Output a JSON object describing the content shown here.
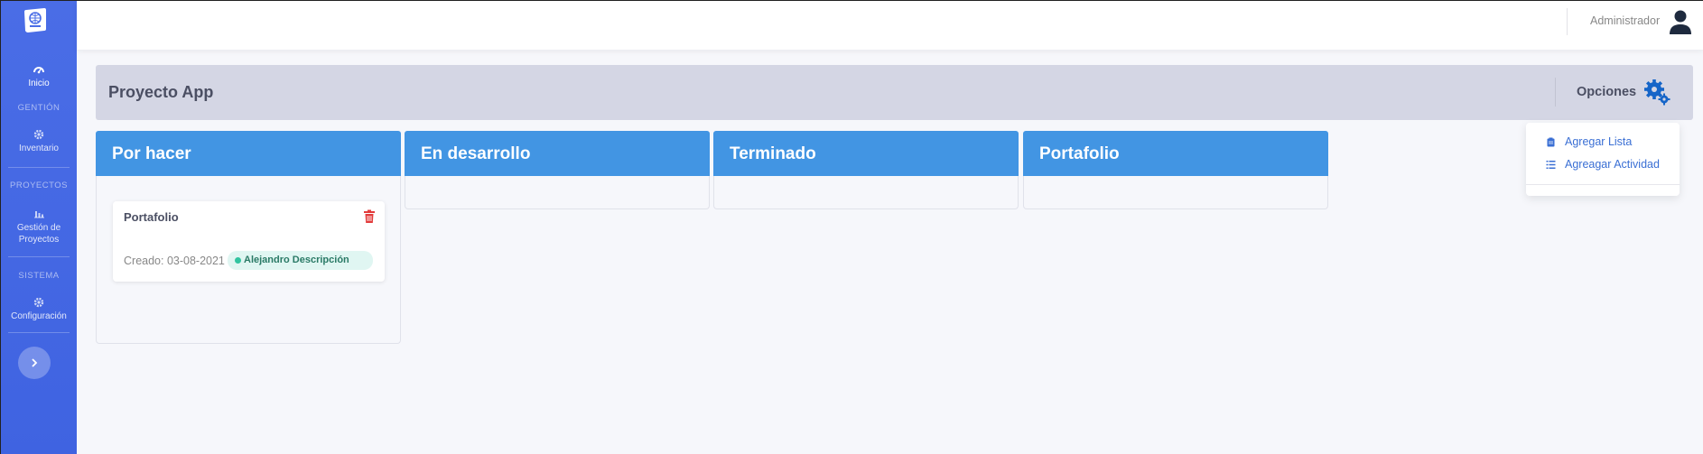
{
  "sidebar": {
    "items": [
      {
        "label": "Inicio",
        "icon": "dashboard-icon"
      },
      {
        "label": "Inventario",
        "icon": "gear-icon"
      },
      {
        "label": "Gestión de Proyectos",
        "icon": "bar-chart-icon"
      },
      {
        "label": "Configuración",
        "icon": "gear-icon"
      }
    ],
    "sections": [
      "GENTIÓN",
      "PROYECTOS",
      "SISTEMA"
    ],
    "expand_icon": "chevron-right-icon"
  },
  "header": {
    "user_name": "Administrador",
    "avatar_icon": "user-icon"
  },
  "project": {
    "title": "Proyecto App",
    "options_label": "Opciones",
    "options_icon": "gears-icon"
  },
  "dropdown": {
    "items": [
      {
        "label": "Agregar Lista",
        "icon": "clipboard-icon"
      },
      {
        "label": "Agreagar Actividad",
        "icon": "list-icon"
      }
    ]
  },
  "board": {
    "columns": [
      {
        "title": "Por hacer"
      },
      {
        "title": "En desarrollo"
      },
      {
        "title": "Terminado"
      },
      {
        "title": "Portafolio"
      }
    ],
    "card": {
      "title": "Portafolio",
      "created": "Creado: 03-08-2021",
      "assignee": "Alejandro Descripción",
      "delete_icon": "trash-icon"
    }
  },
  "colors": {
    "sidebar": "#4a6de6",
    "column_header": "#4295e3",
    "project_bar": "#d4d6e4",
    "link": "#3a6fd4",
    "delete": "#e23b3b",
    "badge_bg": "#e0f6f2",
    "badge_dot": "#31c4a0"
  }
}
